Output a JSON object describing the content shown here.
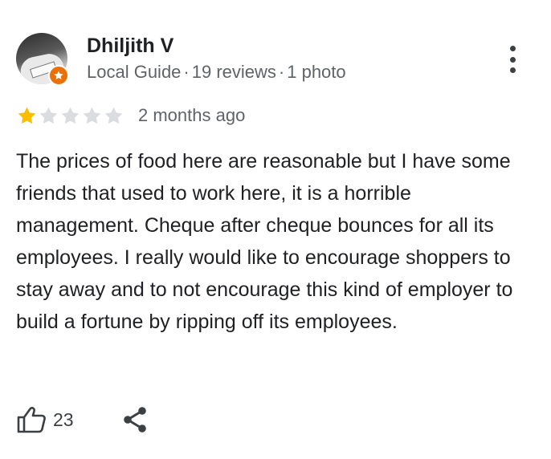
{
  "reviewer": {
    "name": "Dhiljith V",
    "badge": "Local Guide",
    "separator": "·",
    "reviews_count": "19 reviews",
    "photos_count": "1 photo",
    "badge_color": "#e8710a"
  },
  "rating": {
    "value": 1,
    "max": 5,
    "filled_color": "#fbbc04",
    "empty_color": "#dadce0"
  },
  "review": {
    "date": "2 months ago",
    "text": "The prices of food here are reasonable but I have some friends that used to work here, it is a horrible management. Cheque after cheque bounces for all its employees. I really would like to encourage shoppers to stay away and to not encourage this kind of employer to build a fortune by ripping off its employees."
  },
  "actions": {
    "like_count": "23",
    "like_icon": "thumbs-up-icon",
    "share_icon": "share-icon",
    "more_icon": "more-vertical-icon"
  }
}
